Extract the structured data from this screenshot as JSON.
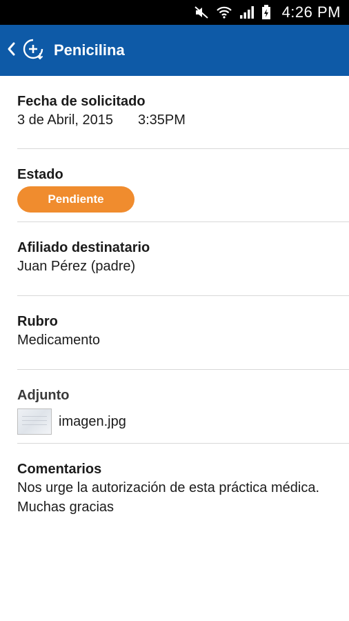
{
  "status_bar": {
    "time": "4:26 PM",
    "icons": [
      "mute-icon",
      "wifi-icon",
      "signal-icon",
      "battery-icon"
    ]
  },
  "app_bar": {
    "title": "Penicilina",
    "icon": "add-medication-icon",
    "color": "#0e5aa7"
  },
  "fields": {
    "fecha": {
      "label": "Fecha de solicitado",
      "date": "3 de Abril, 2015",
      "time": "3:35PM"
    },
    "estado": {
      "label": "Estado",
      "badge": "Pendiente",
      "badge_color": "#f08c2e"
    },
    "afiliado": {
      "label": "Afiliado destinatario",
      "value": "Juan Pérez (padre)"
    },
    "rubro": {
      "label": "Rubro",
      "value": "Medicamento"
    },
    "adjunto": {
      "label": "Adjunto",
      "file_name": "imagen.jpg"
    },
    "comentarios": {
      "label": "Comentarios",
      "value": "Nos urge la autorización de esta práctica médica. Muchas gracias"
    }
  }
}
